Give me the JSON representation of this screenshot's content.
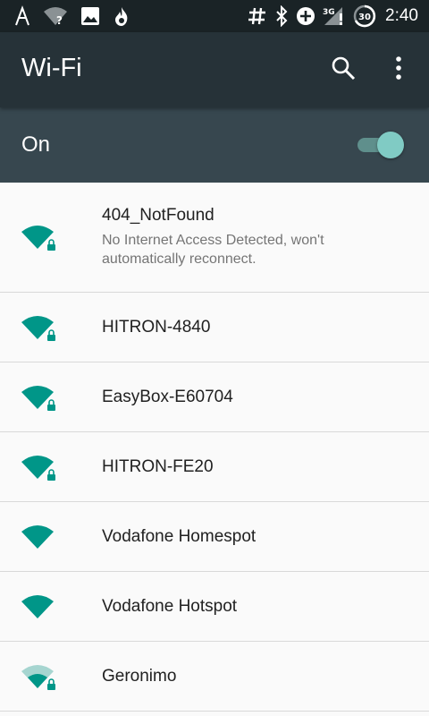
{
  "status_bar": {
    "icons": [
      "notification-a-icon",
      "wifi-unknown-icon",
      "image-icon",
      "fire-icon",
      "hash-icon",
      "bluetooth-icon",
      "data-saver-icon",
      "signal-3g-icon",
      "battery-icon"
    ],
    "signal_type": "3G",
    "battery_level": "30",
    "time": "2:40"
  },
  "app_bar": {
    "title": "Wi-Fi",
    "icons": [
      "search-icon",
      "more-vert-icon"
    ]
  },
  "wifi_toggle": {
    "label": "On",
    "state": "on"
  },
  "networks": [
    {
      "name": "404_NotFound",
      "status": "No Internet Access Detected, won't automatically reconnect.",
      "signal": "full",
      "locked": true
    },
    {
      "name": "HITRON-4840",
      "signal": "full",
      "locked": true
    },
    {
      "name": "EasyBox-E60704",
      "signal": "full",
      "locked": true
    },
    {
      "name": "HITRON-FE20",
      "signal": "full",
      "locked": true
    },
    {
      "name": "Vodafone Homespot",
      "signal": "full",
      "locked": false
    },
    {
      "name": "Vodafone Hotspot",
      "signal": "full",
      "locked": false
    },
    {
      "name": "Geronimo",
      "signal": "weak",
      "locked": true
    }
  ],
  "colors": {
    "accent": "#009688",
    "app_bar": "#263238",
    "toggle_bar": "#37474f",
    "status_bar": "#1a2326",
    "switch_thumb": "#80cbc4"
  }
}
